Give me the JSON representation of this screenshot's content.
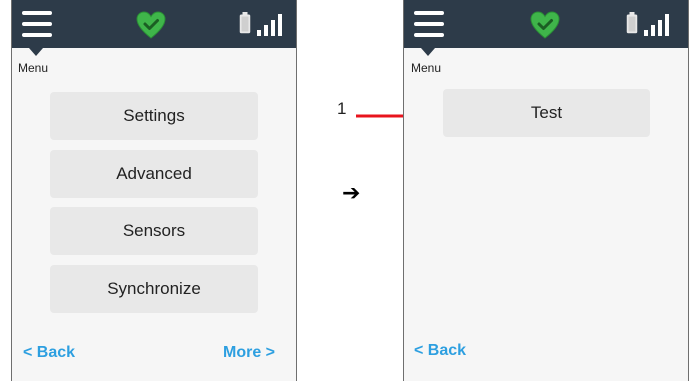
{
  "screens": {
    "left": {
      "menu_label": "Menu",
      "buttons": [
        "Settings",
        "Advanced",
        "Sensors",
        "Synchronize"
      ],
      "back_label": "< Back",
      "more_label": "More >"
    },
    "right": {
      "menu_label": "Menu",
      "buttons": [
        "Test"
      ],
      "back_label": "< Back"
    }
  },
  "callout": {
    "number": "1"
  },
  "flow_arrow": "➔",
  "icons": {
    "menu": "hamburger-menu-icon",
    "status": "heart-check-icon",
    "battery": "battery-icon",
    "signal": "signal-strength-icon"
  },
  "colors": {
    "topbar": "#2d3b49",
    "heart": "#3fb54a",
    "link": "#2d9fe0",
    "button": "#e8e8e8",
    "callout_arrow": "#e8141d"
  }
}
